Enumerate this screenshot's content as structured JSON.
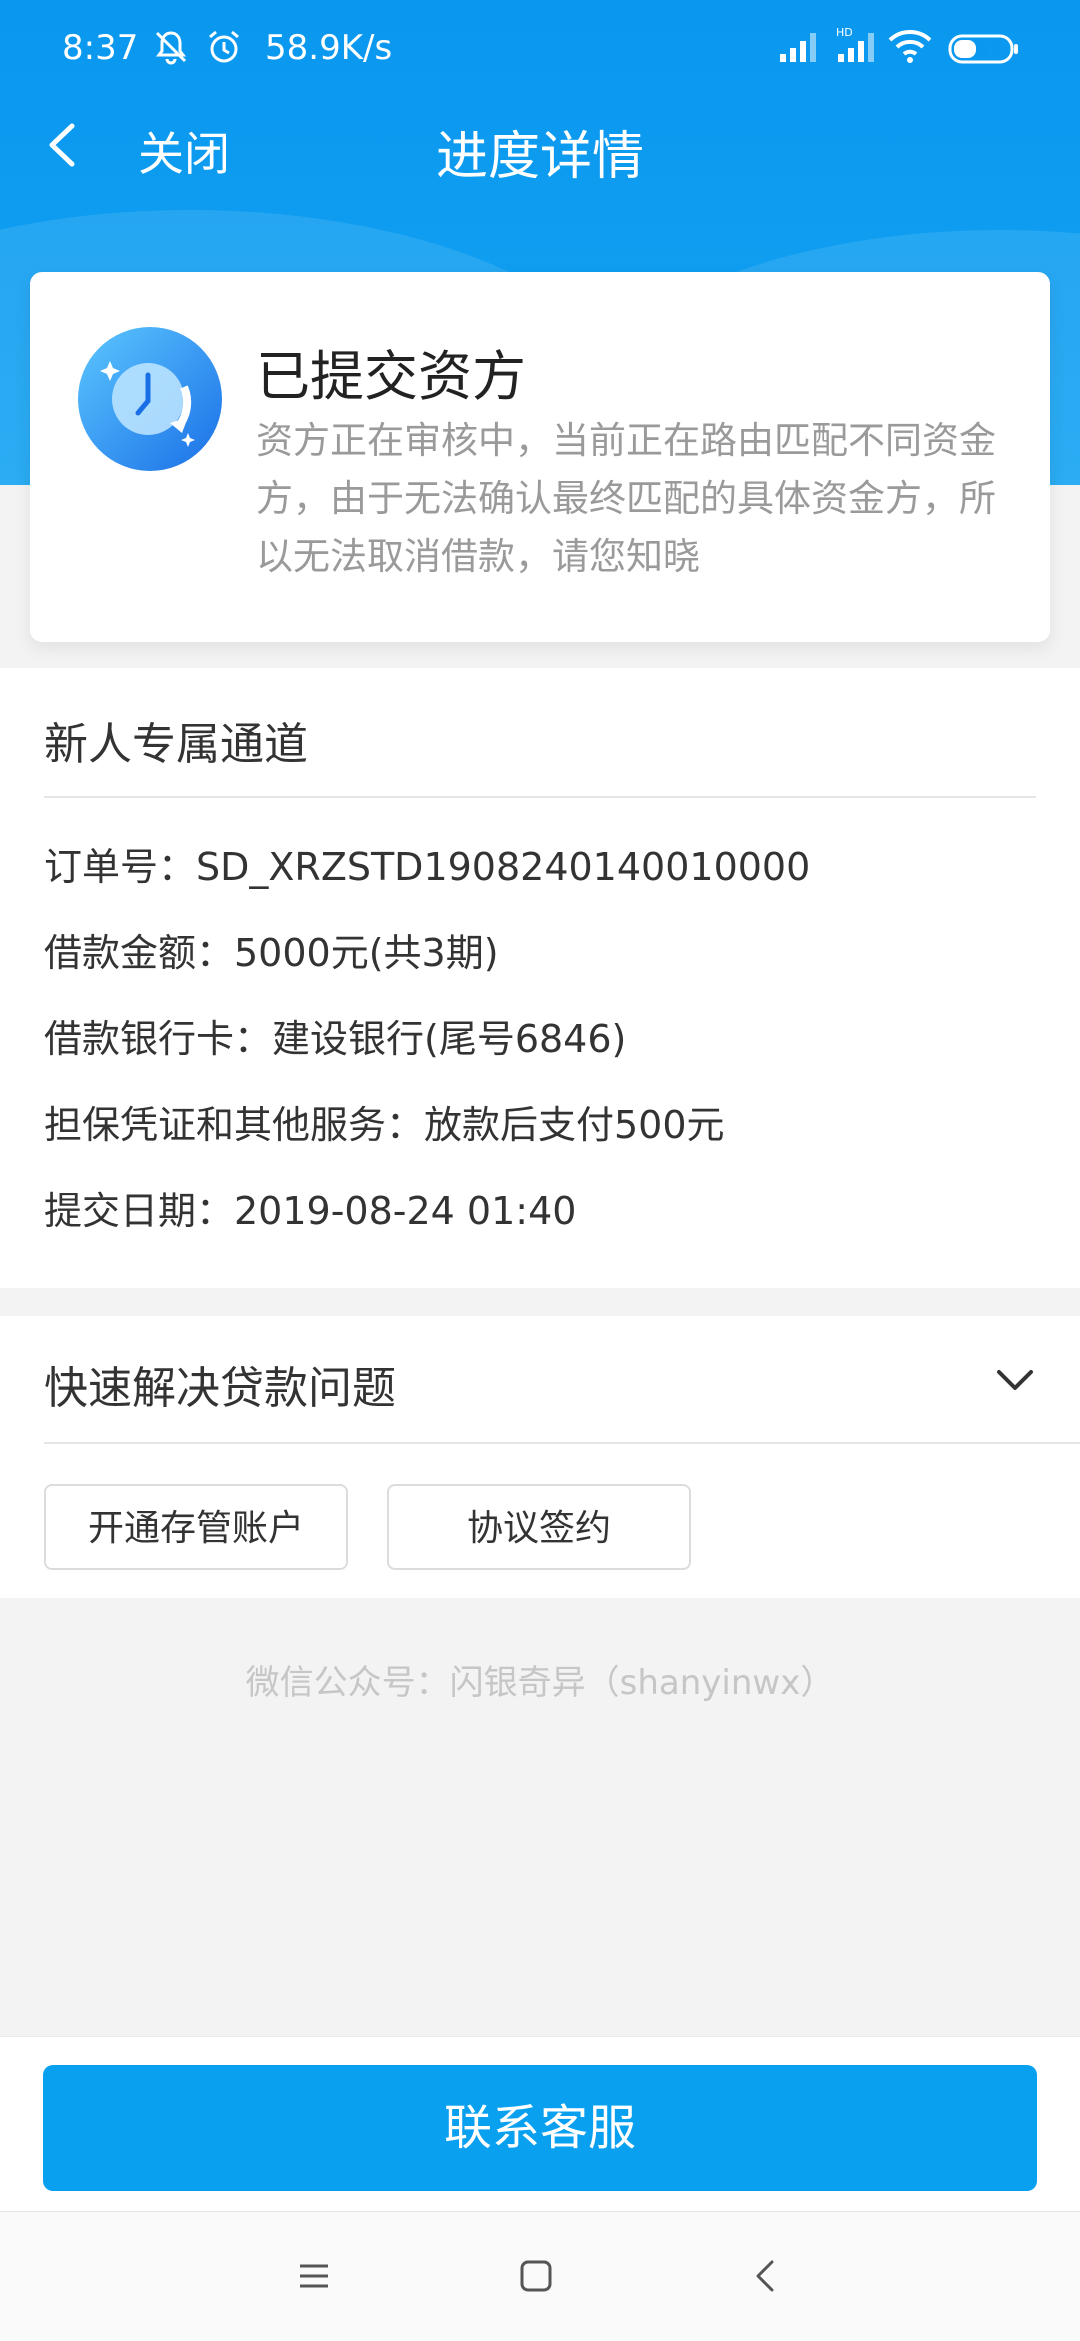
{
  "status_bar": {
    "time": "8:37",
    "speed": "58.9K/s",
    "battery": "37",
    "icons": [
      "mute-bell-icon",
      "alarm-icon",
      "signal-icon",
      "hd-signal-icon",
      "wifi-icon",
      "battery-icon"
    ]
  },
  "nav": {
    "close_label": "关闭",
    "title": "进度详情"
  },
  "status_card": {
    "title": "已提交资方",
    "description": "资方正在审核中，当前正在路由匹配不同资金方，由于无法确认最终匹配的具体资金方，所以无法取消借款，请您知晓",
    "icon": "clock-icon"
  },
  "details": {
    "channel": "新人专属通道",
    "rows": [
      "订单号：SD_XRZSTD1908240140010000",
      "借款金额：5000元(共3期)",
      "借款银行卡：建设银行(尾号6846)",
      "担保凭证和其他服务：放款后支付500元",
      "提交日期：2019-08-24 01:40"
    ]
  },
  "faq": {
    "title": "快速解决贷款问题",
    "buttons": [
      "开通存管账户",
      "协议签约"
    ]
  },
  "watermark": "微信公众号：闪银奇异（shanyinwx）",
  "footer": {
    "contact_label": "联系客服"
  },
  "colors": {
    "brand_blue": "#0a97ef",
    "button_blue": "#0aa0f0"
  }
}
